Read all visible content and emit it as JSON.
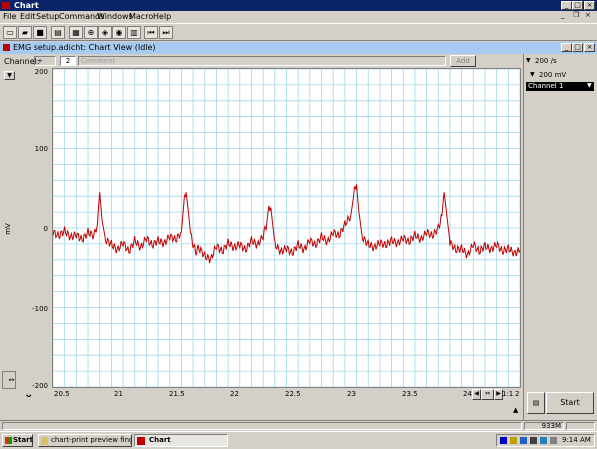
{
  "app": {
    "title": "Chart"
  },
  "menu": [
    "File",
    "Edit",
    "Setup",
    "Commands",
    "Windows",
    "Macro",
    "Help"
  ],
  "document": {
    "title": "EMG setup.adicht: Chart View (Idle)"
  },
  "channel_bar": {
    "label": "Channel:",
    "number": "2",
    "comment_placeholder": "Comment",
    "add_label": "Add"
  },
  "right_panel": {
    "rate": "200 /s",
    "range": "200 mV",
    "channel_select": "Channel 1",
    "start_label": "Start"
  },
  "axis": {
    "ylabel": "mV",
    "yticks": [
      "200",
      "100",
      "0",
      "-100",
      "-200"
    ],
    "xticks": [
      "20.5",
      "21",
      "21.5",
      "22",
      "22.5",
      "23",
      "23.5",
      "24"
    ],
    "xlast": "2",
    "zoom": "1:1"
  },
  "status": {
    "memory": "933M"
  },
  "taskbar": {
    "start": "Start",
    "tasks": [
      "chart-print preview finge...",
      "Chart"
    ],
    "clock": "9:14 AM"
  },
  "colors": {
    "trace": "#c00000",
    "grid": "#9fd7e8",
    "titlebar": "#0a246a",
    "docbar": "#a6caf0"
  },
  "chart_data": {
    "type": "line",
    "ylabel": "mV",
    "xlim": [
      20.5,
      24.5
    ],
    "ylim": [
      -200,
      200
    ],
    "grid": true,
    "series": [
      {
        "color": "#c00000",
        "x": [
          20.5,
          20.55,
          20.6,
          20.65,
          20.7,
          20.75,
          20.8,
          20.85,
          20.88,
          20.9,
          20.92,
          20.95,
          21.0,
          21.05,
          21.1,
          21.15,
          21.2,
          21.25,
          21.3,
          21.35,
          21.4,
          21.45,
          21.5,
          21.55,
          21.6,
          21.62,
          21.64,
          21.66,
          21.68,
          21.7,
          21.72,
          21.75,
          21.8,
          21.85,
          21.9,
          21.95,
          22.0,
          22.05,
          22.1,
          22.15,
          22.2,
          22.25,
          22.3,
          22.33,
          22.35,
          22.37,
          22.4,
          22.45,
          22.5,
          22.55,
          22.6,
          22.65,
          22.7,
          22.75,
          22.8,
          22.85,
          22.9,
          22.95,
          23.0,
          23.05,
          23.08,
          23.1,
          23.12,
          23.15,
          23.2,
          23.25,
          23.3,
          23.35,
          23.4,
          23.45,
          23.5,
          23.55,
          23.6,
          23.65,
          23.7,
          23.75,
          23.8,
          23.83,
          23.85,
          23.87,
          23.9,
          23.95,
          24.0,
          24.05,
          24.1,
          24.15,
          24.2,
          24.25,
          24.3,
          24.35,
          24.4,
          24.45,
          24.5
        ],
        "y": [
          -5,
          -10,
          -3,
          -12,
          -8,
          -15,
          -5,
          -10,
          5,
          45,
          10,
          -15,
          -20,
          -28,
          -18,
          -30,
          -15,
          -25,
          -12,
          -22,
          -15,
          -20,
          -10,
          -15,
          -5,
          30,
          45,
          20,
          -10,
          -20,
          -30,
          -25,
          -35,
          -40,
          -22,
          -30,
          -18,
          -25,
          -20,
          -28,
          -15,
          -22,
          -10,
          5,
          30,
          20,
          -20,
          -30,
          -25,
          -32,
          -20,
          -28,
          -15,
          -22,
          -10,
          -18,
          -5,
          -10,
          5,
          15,
          45,
          55,
          20,
          -12,
          -20,
          -25,
          -18,
          -22,
          -15,
          -20,
          -12,
          -18,
          -8,
          -15,
          -5,
          -10,
          0,
          15,
          45,
          20,
          -18,
          -28,
          -25,
          -35,
          -20,
          -30,
          -22,
          -28,
          -20,
          -30,
          -25,
          -32,
          -28
        ]
      }
    ]
  }
}
